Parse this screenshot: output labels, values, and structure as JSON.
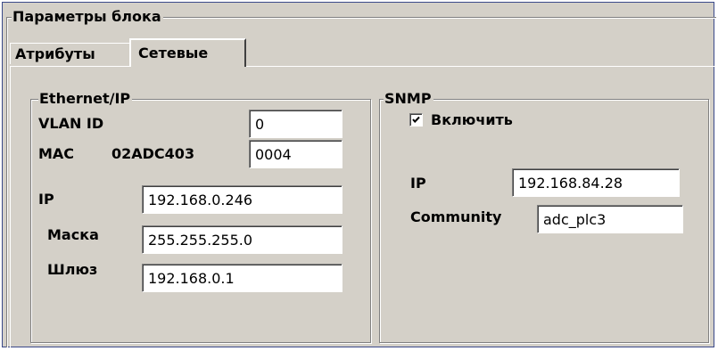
{
  "group_title": "Параметры блока",
  "tabs": [
    {
      "label": "Атрибуты",
      "active": false
    },
    {
      "label": "Сетевые",
      "active": true
    }
  ],
  "ethernet": {
    "title": "Ethernet/IP",
    "vlan_label": "VLAN ID",
    "vlan_value": "0",
    "mac_label": "MAC",
    "mac_prefix": "02ADC403",
    "mac_suffix": "0004",
    "ip_label": "IP",
    "ip_value": "192.168.0.246",
    "mask_label": "Маска",
    "mask_value": "255.255.255.0",
    "gateway_label": "Шлюз",
    "gateway_value": "192.168.0.1"
  },
  "snmp": {
    "title": "SNMP",
    "enable_label": "Включить",
    "enable_checked": true,
    "ip_label": "IP",
    "ip_value": "192.168.84.28",
    "community_label": "Community",
    "community_value": "adc_plc3"
  },
  "colors": {
    "face": "#d4d0c8",
    "frame_border": "#3b4a8a",
    "shadow": "#808080",
    "highlight": "#ffffff"
  },
  "icons": {
    "checkbox": "checkmark-icon"
  }
}
